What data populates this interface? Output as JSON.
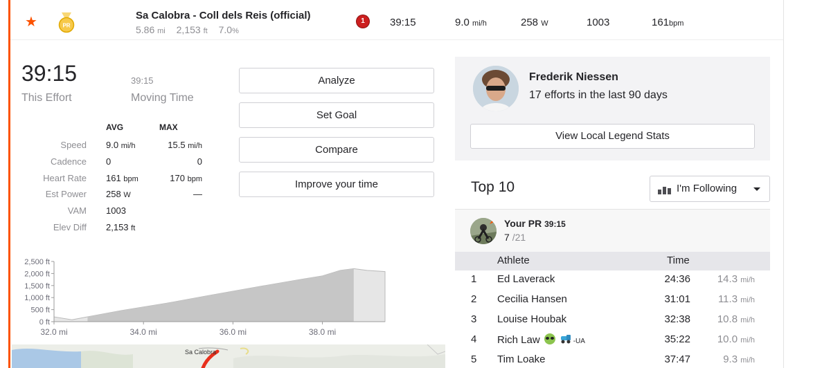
{
  "segment": {
    "name": "Sa Calobra - Coll dels Reis (official)",
    "distance": "5.86",
    "distance_unit": "mi",
    "elevation": "2,153",
    "elevation_unit": "ft",
    "grade": "7.0",
    "grade_unit": "%",
    "rank_badge": "1",
    "time": "39:15",
    "speed": "9.0",
    "speed_unit": "mi/h",
    "power": "258",
    "power_unit": "W",
    "vam": "1003",
    "hr": "161",
    "hr_unit": "bpm",
    "medal_label": "PR"
  },
  "effort": {
    "time": "39:15",
    "time_label": "This Effort",
    "moving_time": "39:15",
    "moving_label": "Moving Time"
  },
  "stats": {
    "avg_header": "AVG",
    "max_header": "MAX",
    "rows": [
      {
        "label": "Speed",
        "avg": "9.0",
        "avg_unit": "mi/h",
        "max": "15.5",
        "max_unit": "mi/h"
      },
      {
        "label": "Cadence",
        "avg": "0",
        "avg_unit": "",
        "max": "0",
        "max_unit": ""
      },
      {
        "label": "Heart Rate",
        "avg": "161",
        "avg_unit": "bpm",
        "max": "170",
        "max_unit": "bpm"
      },
      {
        "label": "Est Power",
        "avg": "258",
        "avg_unit": "W",
        "max": "—",
        "max_unit": ""
      },
      {
        "label": "VAM",
        "avg": "1003",
        "avg_unit": "",
        "max": "",
        "max_unit": ""
      },
      {
        "label": "Elev Diff",
        "avg": "2,153",
        "avg_unit": "ft",
        "max": "",
        "max_unit": ""
      }
    ]
  },
  "buttons": {
    "analyze": "Analyze",
    "set_goal": "Set Goal",
    "compare": "Compare",
    "improve": "Improve your time"
  },
  "elevation_chart": {
    "type": "area",
    "y_ticks": [
      "2,500 ft",
      "2,000 ft",
      "1,500 ft",
      "1,000 ft",
      "500 ft",
      "0 ft"
    ],
    "y_tick_values": [
      2500,
      2000,
      1500,
      1000,
      500,
      0
    ],
    "x_ticks": [
      "32.0 mi",
      "34.0 mi",
      "36.0 mi",
      "38.0 mi"
    ],
    "x_tick_values": [
      32.0,
      34.0,
      36.0,
      38.0
    ],
    "xlim": [
      32.0,
      39.4
    ],
    "ylim": [
      0,
      2500
    ],
    "segment_range": [
      32.75,
      38.7
    ],
    "x": [
      32.0,
      32.4,
      32.75,
      33.5,
      34.5,
      35.5,
      36.5,
      37.5,
      38.0,
      38.4,
      38.7,
      39.0,
      39.4
    ],
    "y": [
      200,
      80,
      200,
      460,
      760,
      1100,
      1430,
      1750,
      1900,
      2130,
      2200,
      2130,
      2080
    ]
  },
  "map": {
    "place_label": "Sa Calobra"
  },
  "local_legend": {
    "name": "Frederik Niessen",
    "efforts": "17 efforts in the last 90 days",
    "button": "View Local Legend Stats"
  },
  "leaderboard": {
    "title": "Top 10",
    "filter": "I'm Following",
    "pr_label": "Your PR",
    "pr_time": "39:15",
    "pr_rank": "7",
    "pr_total": "/21",
    "col_athlete": "Athlete",
    "col_time": "Time",
    "rows": [
      {
        "rank": "1",
        "athlete": "Ed Laverack",
        "time": "24:36",
        "speed": "14.3",
        "unit": "mi/h"
      },
      {
        "rank": "2",
        "athlete": "Cecilia Hansen",
        "time": "31:01",
        "speed": "11.3",
        "unit": "mi/h"
      },
      {
        "rank": "3",
        "athlete": "Louise Houbak",
        "time": "32:38",
        "speed": "10.8",
        "unit": "mi/h"
      },
      {
        "rank": "4",
        "athlete": "Rich Law",
        "time": "35:22",
        "speed": "10.0",
        "unit": "mi/h",
        "suffix": "-UA"
      },
      {
        "rank": "5",
        "athlete": "Tim Loake",
        "time": "37:47",
        "speed": "9.3",
        "unit": "mi/h"
      }
    ]
  },
  "colors": {
    "accent": "#fc5200",
    "badge_red": "#cc1f1f",
    "medal_gold": "#f2b705",
    "route_red": "#e8301c"
  }
}
